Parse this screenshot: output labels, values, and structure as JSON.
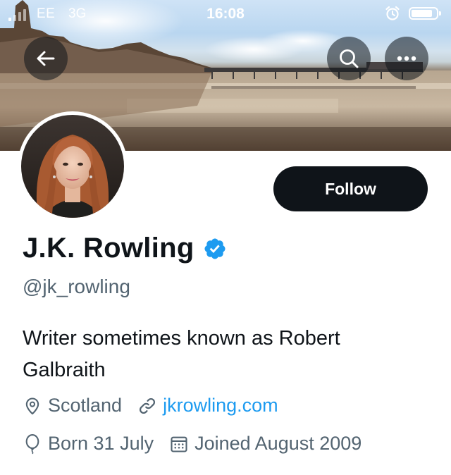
{
  "status_bar": {
    "carrier": "EE",
    "network": "3G",
    "time": "16:08",
    "battery_level": 0.85
  },
  "header": {
    "back_icon": "arrow-left-icon",
    "search_icon": "search-icon",
    "more_icon": "more-horizontal-icon"
  },
  "profile": {
    "follow_label": "Follow",
    "name": "J.K. Rowling",
    "verified_icon": "verified-badge-icon",
    "handle": "@jk_rowling",
    "bio": "Writer sometimes known as Robert Galbraith",
    "location": "Scotland",
    "website": "jkrowling.com",
    "birthday": "Born 31 July",
    "joined": "Joined August 2009"
  },
  "colors": {
    "text_primary": "#0f1419",
    "text_secondary": "#536471",
    "link": "#1d9bf0",
    "verified": "#1d9bf0",
    "follow_bg": "#0f1419",
    "follow_text": "#ffffff"
  }
}
